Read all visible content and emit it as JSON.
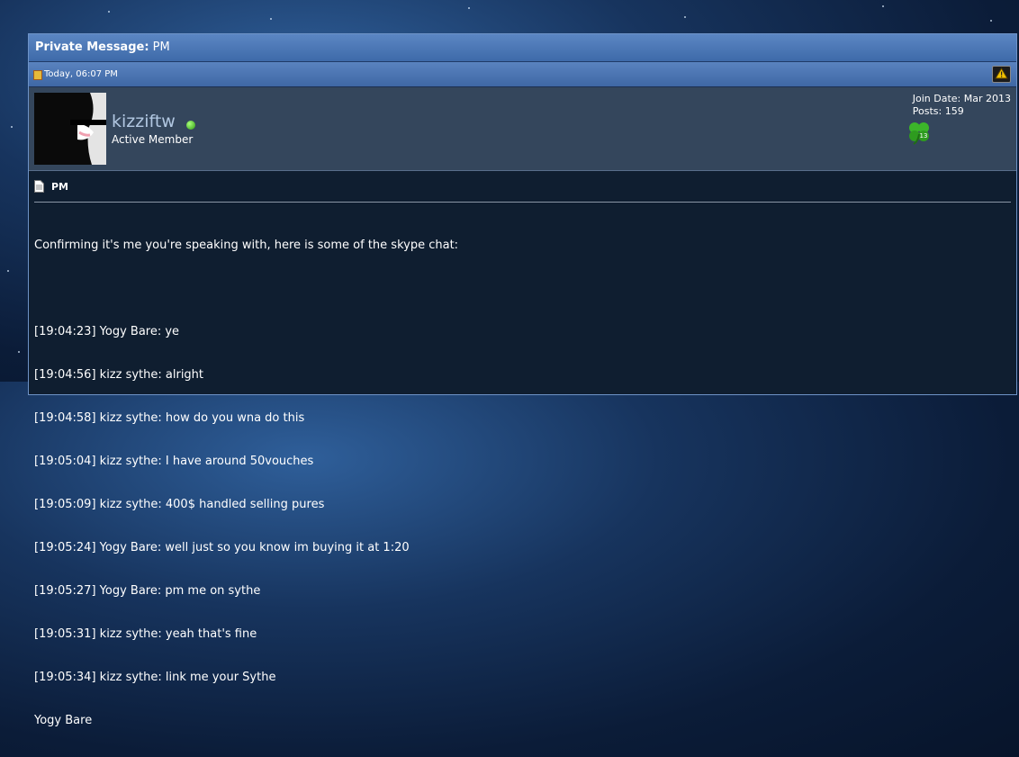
{
  "header": {
    "title_label": "Private Message",
    "title_value": "PM"
  },
  "post": {
    "date": "Today, 06:07 PM",
    "user": {
      "name": "kizziftw",
      "title": "Active Member",
      "join_label": "Join Date:",
      "join_value": "Mar 2013",
      "posts_label": "Posts:",
      "posts_value": "159",
      "award_badge": "13"
    },
    "message": {
      "title": "PM",
      "lines": [
        "Confirming it's me you're speaking with, here is some of the skype chat:",
        "",
        "[19:04:23] Yogy Bare: ye",
        "[19:04:56] kizz sythe: alright",
        "[19:04:58] kizz sythe: how do you wna do this",
        "[19:05:04] kizz sythe: I have around 50vouches",
        "[19:05:09] kizz sythe: 400$ handled selling pures",
        "[19:05:24] Yogy Bare: well just so you know im buying it at 1:20",
        "[19:05:27] Yogy Bare: pm me on sythe",
        "[19:05:31] kizz sythe: yeah that's fine",
        "[19:05:34] kizz sythe: link me your Sythe",
        "Yogy Bare"
      ]
    }
  },
  "icons": [
    "post-status-icon",
    "report-icon",
    "online-status-icon",
    "award-clover-icon",
    "document-icon"
  ],
  "colors": {
    "title_bar": "#4f7ab8",
    "user_row": "#34465c",
    "message_bg": "#0f1e30",
    "username": "#b2c8e2",
    "online": "#2e9b12"
  }
}
